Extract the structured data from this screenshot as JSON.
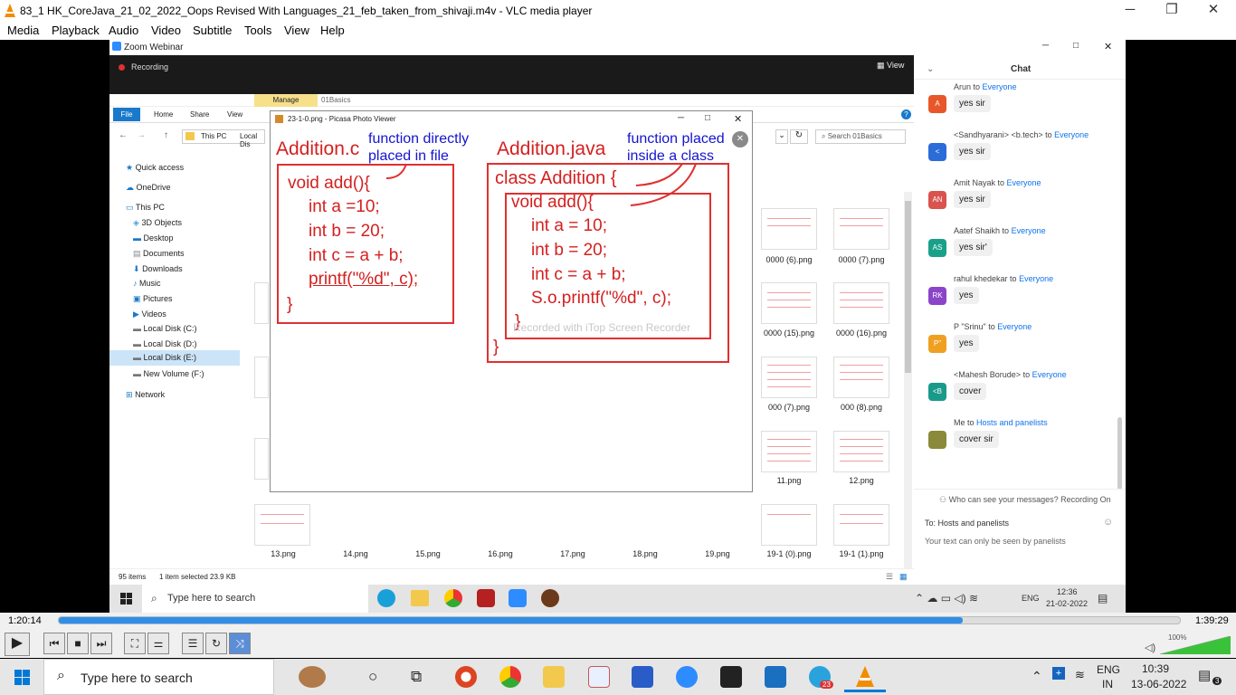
{
  "vlc": {
    "title": "83_1 HK_CoreJava_21_02_2022_Oops Revised With Languages_21_feb_taken_from_shivaji.m4v - VLC media player",
    "menu": [
      "Media",
      "Playback",
      "Audio",
      "Video",
      "Subtitle",
      "Tools",
      "View",
      "Help"
    ],
    "time_elapsed": "1:20:14",
    "time_total": "1:39:29",
    "progress": 0.806,
    "volume": "100%"
  },
  "zoom": {
    "title": "Zoom Webinar",
    "recording": "Recording",
    "view": "View"
  },
  "explorer": {
    "tabs": [
      "File",
      "Home",
      "Share",
      "View"
    ],
    "manage": "Manage",
    "folder": "01Basics",
    "breadcrumb": [
      "This PC",
      "Local Dis"
    ],
    "search_placeholder": "Search 01Basics",
    "nav": [
      "Quick access",
      "OneDrive",
      "This PC",
      "3D Objects",
      "Desktop",
      "Documents",
      "Downloads",
      "Music",
      "Pictures",
      "Videos",
      "Local Disk (C:)",
      "Local Disk (D:)",
      "Local Disk (E:)",
      "New Volume (F:)",
      "Network"
    ],
    "status_items": "95 items",
    "status_selected": "1 item selected  23.9 KB",
    "grid_labels_right": [
      "0000 (6).png",
      "0000 (7).png",
      "0000 (15).png",
      "0000 (16).png",
      "000 (7).png",
      "000 (8).png",
      "11.png",
      "12.png"
    ],
    "bottom_labels": [
      "13.png",
      "14.png",
      "15.png",
      "16.png",
      "17.png",
      "18.png",
      "19.png",
      "19-1 (0).png",
      "19-1 (1).png"
    ]
  },
  "picasa": {
    "title": "23-1-0.png - Picasa Photo Viewer",
    "left_heading": "Addition.c",
    "left_note_1": "function directly",
    "left_note_2": "placed in file",
    "left_code": [
      "void add(){",
      "int a =10;",
      "int b = 20;",
      "int c = a + b;",
      "printf(\"%d\", c);",
      "}"
    ],
    "right_heading": "Addition.java",
    "right_note_1": "function placed",
    "right_note_2": "inside a class",
    "right_code": [
      "class Addition {",
      "void add(){",
      "int a = 10;",
      "int b = 20;",
      "int c = a + b;",
      "S.o.printf(\"%d\", c);",
      "}",
      "}"
    ],
    "watermark": "Recorded with iTop Screen Recorder"
  },
  "chat": {
    "title": "Chat",
    "messages": [
      {
        "from": "Arun",
        "to": "Everyone",
        "text": "yes sir",
        "initials": "A",
        "color": "#e8572a"
      },
      {
        "from": "<Sandhyarani> <b.tech>",
        "to": "Everyone",
        "text": "yes sir",
        "initials": "<",
        "color": "#2b6cd8"
      },
      {
        "from": "Amit Nayak",
        "to": "Everyone",
        "text": "yes sir",
        "initials": "AN",
        "color": "#d9534f"
      },
      {
        "from": "Aatef Shaikh",
        "to": "Everyone",
        "text": "yes sir'",
        "initials": "AS",
        "color": "#1aa08a"
      },
      {
        "from": "rahul khedekar",
        "to": "Everyone",
        "text": "yes",
        "initials": "RK",
        "color": "#8b45c8"
      },
      {
        "from": "P \"Srinu\"",
        "to": "Everyone",
        "text": "yes",
        "initials": "P\"",
        "color": "#f0a020"
      },
      {
        "from": "<Mahesh Borude>",
        "to": "Everyone",
        "text": "cover",
        "initials": "<B",
        "color": "#1a9a8a"
      },
      {
        "from": "Me",
        "to": "Hosts and panelists",
        "text": "cover sir",
        "initials": "",
        "color": "#8a8a3a"
      }
    ],
    "to_word": "to",
    "who_can_see": "Who can see your messages? Recording On",
    "to_label": "To: Hosts and panelists",
    "hint": "Your text can only be seen by panelists"
  },
  "inner_taskbar": {
    "search": "Type here to search",
    "lang": "ENG",
    "time": "12:36",
    "date": "21-02-2022"
  },
  "taskbar": {
    "search": "Type here to search",
    "lang1": "ENG",
    "lang2": "IN",
    "time": "10:39",
    "date": "13-06-2022",
    "badge": "23",
    "notif": "3"
  }
}
